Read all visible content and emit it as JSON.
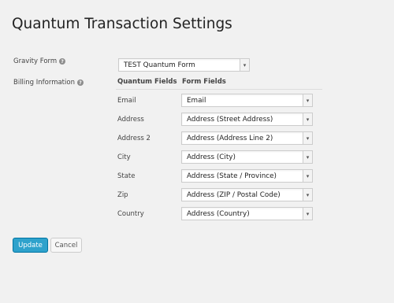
{
  "page_title": "Quantum Transaction Settings",
  "gravity_form": {
    "label": "Gravity Form",
    "help_icon": "?",
    "selected": "TEST Quantum Form"
  },
  "billing": {
    "label": "Billing Information",
    "help_icon": "?",
    "col_quantum": "Quantum Fields",
    "col_form": "Form Fields",
    "rows": [
      {
        "field": "Email",
        "value": "Email"
      },
      {
        "field": "Address",
        "value": "Address (Street Address)"
      },
      {
        "field": "Address 2",
        "value": "Address (Address Line 2)"
      },
      {
        "field": "City",
        "value": "Address (City)"
      },
      {
        "field": "State",
        "value": "Address (State / Province)"
      },
      {
        "field": "Zip",
        "value": "Address (ZIP / Postal Code)"
      },
      {
        "field": "Country",
        "value": "Address (Country)"
      }
    ]
  },
  "buttons": {
    "update": "Update",
    "cancel": "Cancel"
  },
  "colors": {
    "primary": "#2ea2cc",
    "background": "#f1f1f1"
  },
  "icons": {
    "help": "help-icon",
    "dropdown": "chevron-down-icon"
  }
}
